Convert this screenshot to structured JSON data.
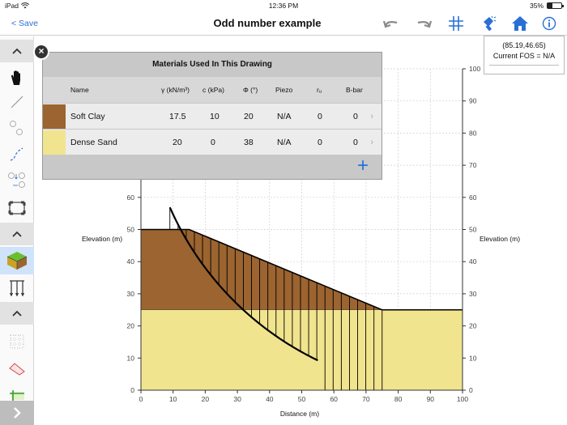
{
  "status_bar": {
    "device": "iPad",
    "time": "12:36 PM",
    "battery": "35%",
    "battery_level": 0.35
  },
  "nav": {
    "back_label": "< Save",
    "title": "Odd number example"
  },
  "cursor_readout": {
    "coords": "(85.19,46.65)",
    "fos": "Current FOS = N/A"
  },
  "chart_data": {
    "type": "area",
    "xlabel": "Distance (m)",
    "ylabel_left": "Elevation (m)",
    "ylabel_right": "Elevation (m)",
    "xlim": [
      0,
      100
    ],
    "ylim": [
      0,
      100
    ],
    "x_ticks": [
      0,
      10,
      20,
      30,
      40,
      50,
      60,
      70,
      80,
      90,
      100
    ],
    "y_ticks": [
      0,
      10,
      20,
      30,
      40,
      50,
      60,
      70,
      80,
      90,
      100
    ],
    "materials_regions": [
      {
        "name": "Soft Clay",
        "color": "#9b6430",
        "polygon": [
          [
            0,
            50
          ],
          [
            15,
            50
          ],
          [
            75,
            25
          ],
          [
            0,
            25
          ]
        ]
      },
      {
        "name": "Dense Sand",
        "color": "#f1e48e",
        "polygon": [
          [
            0,
            25
          ],
          [
            100,
            25
          ],
          [
            100,
            0
          ],
          [
            0,
            0
          ]
        ]
      }
    ],
    "ground_surface": [
      [
        0,
        50
      ],
      [
        15,
        50
      ],
      [
        75,
        25
      ],
      [
        100,
        25
      ]
    ],
    "slip_circle": {
      "center": [
        96.5,
        95.4
      ],
      "radius": 95.6,
      "entry": [
        9,
        50
      ],
      "exit": [
        55,
        9.7
      ]
    },
    "slices": {
      "count": 27,
      "x_start": 9,
      "x_end": 75
    }
  },
  "materials": {
    "title": "Materials Used In This Drawing",
    "headers": {
      "name": "Name",
      "gamma": "γ (kN/m³)",
      "c": "c (kPa)",
      "phi": "Φ (°)",
      "piezo": "Piezo",
      "ru": "rᵤ",
      "bbar": "B-bar"
    },
    "rows": [
      {
        "color": "#9b6430",
        "name": "Soft Clay",
        "gamma": "17.5",
        "c": "10",
        "phi": "20",
        "piezo": "N/A",
        "ru": "0",
        "bbar": "0"
      },
      {
        "color": "#f1e48e",
        "name": "Dense Sand",
        "gamma": "20",
        "c": "0",
        "phi": "38",
        "piezo": "N/A",
        "ru": "0",
        "bbar": "0"
      }
    ],
    "add_label": "+"
  },
  "colors": {
    "accent": "#2a6fd6",
    "clay": "#9b6430",
    "sand": "#f1e48e",
    "active_tool_bg": "#cfe3fb"
  },
  "toolbar_icons": [
    "undo-icon",
    "redo-icon",
    "grid-icon",
    "flashlight-icon",
    "home-icon",
    "info-icon"
  ],
  "sidebar_icons": [
    "chevron-up-icon",
    "hand-icon",
    "line-icon",
    "point-icon",
    "polyline-icon",
    "point-pair-icon",
    "select-box-icon",
    "chevron-up-icon",
    "material-block-icon",
    "piezo-icon",
    "chevron-up-icon",
    "dotted-grid-icon",
    "region-icon",
    "pan-icon",
    "chevron-right-icon"
  ]
}
